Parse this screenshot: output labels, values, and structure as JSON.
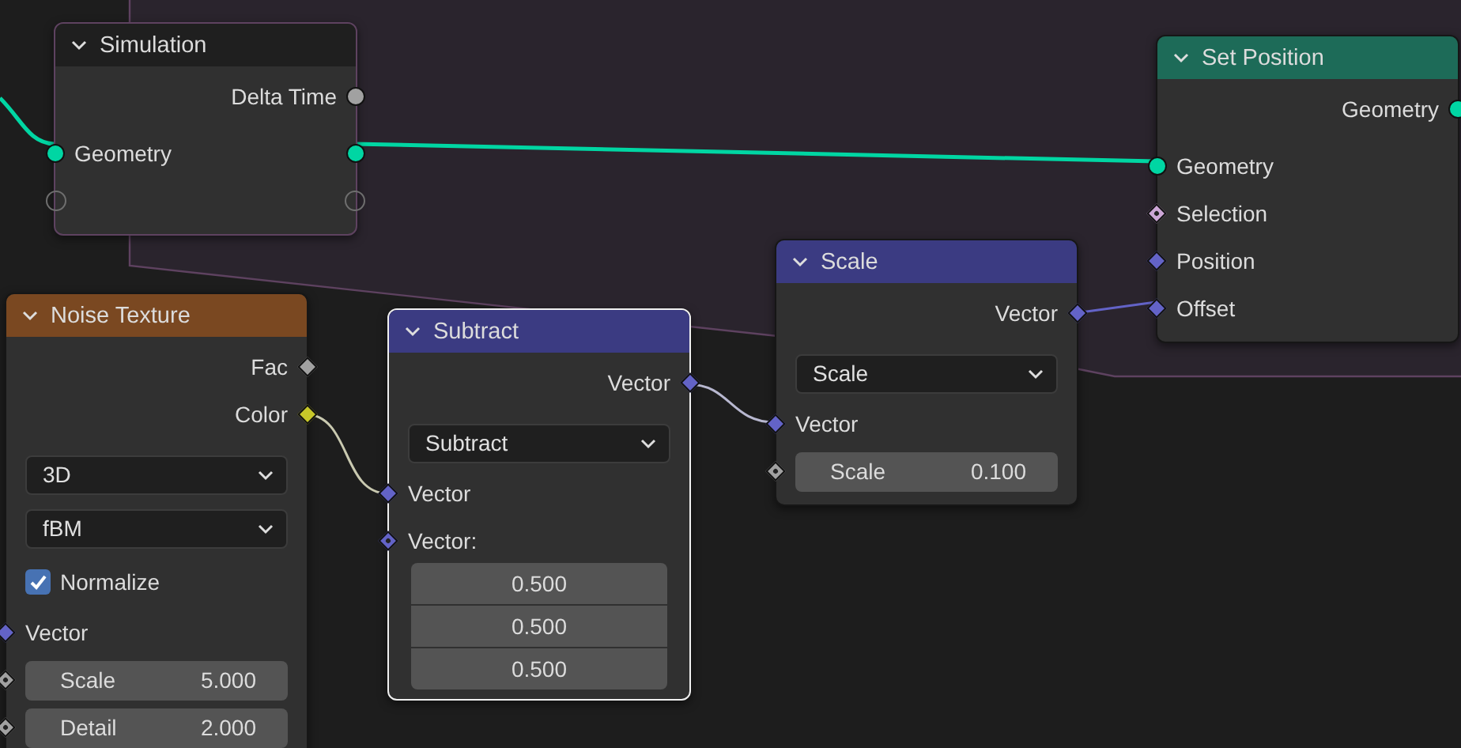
{
  "nodes": [
    {
      "title": "Simulation",
      "color": "#1f1f1f",
      "selected": false,
      "rows": [
        {
          "kind": "output",
          "label": "Delta Time",
          "out": {
            "kind": "circle",
            "color": "#a1a1a1"
          }
        },
        {
          "kind": "input",
          "label": "Geometry",
          "in": {
            "kind": "circle",
            "color": "#00d6a3"
          },
          "out": {
            "kind": "circle",
            "color": "#00d6a3"
          }
        },
        {
          "kind": "empty",
          "in": {
            "kind": "hollow",
            "color": "#6e6e6e"
          },
          "out": {
            "kind": "hollow",
            "color": "#6e6e6e"
          }
        }
      ]
    },
    {
      "title": "Set Position",
      "color": "#1d6b58",
      "selected": false,
      "rows": [
        {
          "kind": "output",
          "label": "Geometry",
          "out": {
            "kind": "circle",
            "color": "#00d6a3"
          }
        },
        {
          "kind": "input",
          "label": "Geometry",
          "in": {
            "kind": "circle",
            "color": "#00d6a3"
          }
        },
        {
          "kind": "input",
          "label": "Selection",
          "in": {
            "kind": "diamond_dot",
            "color": "#cca6d6"
          }
        },
        {
          "kind": "input",
          "label": "Position",
          "in": {
            "kind": "diamond",
            "color": "#6363c7"
          }
        },
        {
          "kind": "input",
          "label": "Offset",
          "in": {
            "kind": "diamond",
            "color": "#6363c7"
          }
        }
      ]
    },
    {
      "title": "Scale",
      "color": "#3b3b82",
      "selected": false,
      "rows": [
        {
          "kind": "output",
          "label": "Vector",
          "out": {
            "kind": "diamond",
            "color": "#6363c7"
          }
        },
        {
          "kind": "dropdown",
          "label": "Scale"
        },
        {
          "kind": "input",
          "label": "Vector",
          "in": {
            "kind": "diamond",
            "color": "#6363c7"
          }
        },
        {
          "kind": "field",
          "label": "Scale",
          "value": "0.100",
          "in": {
            "kind": "diamond_dot",
            "color": "#a1a1a1"
          }
        }
      ]
    },
    {
      "title": "Noise Texture",
      "color": "#7a4821",
      "selected": false,
      "rows": [
        {
          "kind": "output",
          "label": "Fac",
          "out": {
            "kind": "diamond",
            "color": "#a1a1a1"
          }
        },
        {
          "kind": "output",
          "label": "Color",
          "out": {
            "kind": "diamond",
            "color": "#c7c729"
          }
        },
        {
          "kind": "dropdown",
          "label": "3D"
        },
        {
          "kind": "dropdown",
          "label": "fBM"
        },
        {
          "kind": "checkbox",
          "label": "Normalize",
          "checked": true
        },
        {
          "kind": "input",
          "label": "Vector",
          "in": {
            "kind": "diamond",
            "color": "#6363c7"
          }
        },
        {
          "kind": "field",
          "label": "Scale",
          "value": "5.000",
          "in": {
            "kind": "diamond_dot",
            "color": "#a1a1a1"
          }
        },
        {
          "kind": "field",
          "label": "Detail",
          "value": "2.000",
          "in": {
            "kind": "diamond_dot",
            "color": "#a1a1a1"
          }
        }
      ]
    },
    {
      "title": "Subtract",
      "color": "#3b3b82",
      "selected": true,
      "rows": [
        {
          "kind": "output",
          "label": "Vector",
          "out": {
            "kind": "diamond",
            "color": "#6363c7"
          }
        },
        {
          "kind": "dropdown",
          "label": "Subtract"
        },
        {
          "kind": "input",
          "label": "Vector",
          "in": {
            "kind": "diamond",
            "color": "#6363c7"
          }
        },
        {
          "kind": "input",
          "label": "Vector:",
          "in": {
            "kind": "diamond_dot",
            "color": "#6363c7"
          }
        },
        {
          "kind": "values",
          "values": [
            "0.500",
            "0.500",
            "0.500"
          ]
        }
      ]
    }
  ]
}
